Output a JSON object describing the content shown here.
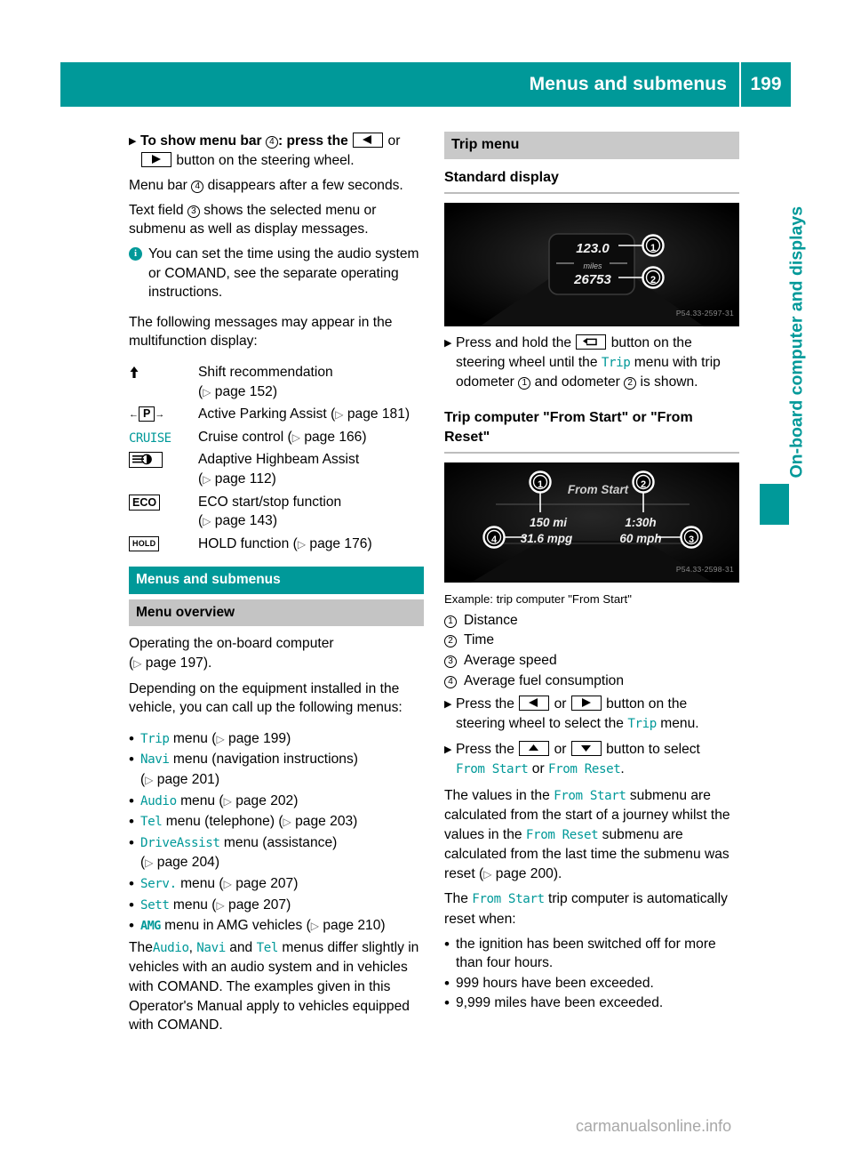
{
  "header": {
    "title": "Menus and submenus",
    "page_number": "199",
    "accent_color": "#009999"
  },
  "side_tab": {
    "label": "On-board computer and displays"
  },
  "left_column": {
    "step_show_menu_bar": {
      "bold_lead": "To show menu bar",
      "callout": "4",
      "after_callout": ": press the",
      "or_word": "or",
      "tail": "button on the steering wheel."
    },
    "para_menu_bar_disappears_pre": "Menu bar",
    "para_menu_bar_callout": "4",
    "para_menu_bar_disappears_post": "disappears after a few seconds.",
    "para_text_field_pre": "Text field",
    "para_text_field_callout": "3",
    "para_text_field_post": "shows the selected menu or submenu as well as display messages.",
    "note": "You can set the time using the audio system or COMAND, see the separate operating instructions.",
    "messages_intro": "The following messages may appear in the multifunction display:",
    "messages": [
      {
        "icon": "shift-up-arrow-icon",
        "icon_text": "⬆",
        "label": "Shift recommendation",
        "page_ref": "page 152",
        "ref_on_new_line": true
      },
      {
        "icon": "active-parking-assist-icon",
        "icon_text": "P",
        "label": "Active Parking Assist",
        "page_ref": "page 181",
        "ref_on_new_line": false
      },
      {
        "icon": "cruise-icon",
        "icon_text": "CRUISE",
        "label": "Cruise control",
        "page_ref": "page 166",
        "ref_on_new_line": false
      },
      {
        "icon": "adaptive-highbeam-assist-icon",
        "icon_text": "",
        "label": "Adaptive Highbeam Assist",
        "page_ref": "page 112",
        "ref_on_new_line": true
      },
      {
        "icon": "eco-icon",
        "icon_text": "ECO",
        "label": "ECO start/stop function",
        "page_ref": "page 143",
        "ref_on_new_line": true
      },
      {
        "icon": "hold-icon",
        "icon_text": "HOLD",
        "label": "HOLD function",
        "page_ref": "page 176",
        "ref_on_new_line": false
      }
    ],
    "section_bar": "Menus and submenus",
    "subsection_bar": "Menu overview",
    "operating_line1": "Operating the on-board computer",
    "operating_ref": "page 197",
    "operating_tail": ").",
    "depending_text": "Depending on the equipment installed in the vehicle, you can call up the following menus:",
    "menu_items": [
      {
        "term": "Trip",
        "desc": "menu",
        "page_ref": "page 199",
        "ref_new_line": false
      },
      {
        "term": "Navi",
        "desc": "menu (navigation instructions)",
        "page_ref": "page 201",
        "ref_new_line": true
      },
      {
        "term": "Audio",
        "desc": "menu",
        "page_ref": "page 202",
        "ref_new_line": false
      },
      {
        "term": "Tel",
        "desc": "menu (telephone)",
        "page_ref": "page 203",
        "ref_new_line": false
      },
      {
        "term": "DriveAssist",
        "desc": "menu (assistance)",
        "page_ref": "page 204",
        "ref_new_line": true
      },
      {
        "term": "Serv.",
        "desc": "menu",
        "page_ref": "page 207",
        "ref_new_line": false
      },
      {
        "term": "Sett",
        "desc": "menu",
        "page_ref": "page 207",
        "ref_new_line": false
      },
      {
        "term": "AMG",
        "desc": "menu in AMG vehicles",
        "page_ref": "page 210",
        "ref_new_line": false
      }
    ],
    "closing_paragraph": {
      "p1": "The",
      "t1": "Audio",
      "p2": ",",
      "t2": "Navi",
      "p3": "and",
      "t3": "Tel",
      "p4": "menus differ slightly in vehicles with an audio system and in vehicles with COMAND. The examples given in this Operator's Manual apply to vehicles equipped with COMAND."
    }
  },
  "right_column": {
    "trip_menu_bar": "Trip menu",
    "standard_display_heading": "Standard display",
    "figure1": {
      "odometer_trip": "123.0",
      "unit": "miles",
      "odometer_total": "26753",
      "callout_1": "1",
      "callout_2": "2",
      "code": "P54.33-2597-31"
    },
    "step_press_hold": {
      "lead": "Press and hold the",
      "mid": "button on the steering wheel until the",
      "term": "Trip",
      "mid2": "menu with trip odometer",
      "callout_1": "1",
      "and": "and odometer",
      "callout_2": "2",
      "tail": "is shown."
    },
    "trip_computer_heading": "Trip computer \"From Start\" or \"From Reset\"",
    "figure2": {
      "title": "From Start",
      "distance": "150 mi",
      "time": "1:30h",
      "consumption": "31.6 mpg",
      "speed": "60 mph",
      "callout_1": "1",
      "callout_2": "2",
      "callout_3": "3",
      "callout_4": "4",
      "code": "P54.33-2598-31"
    },
    "figure2_caption": "Example: trip computer \"From Start\"",
    "legend": [
      {
        "num": "1",
        "label": "Distance"
      },
      {
        "num": "2",
        "label": "Time"
      },
      {
        "num": "3",
        "label": "Average speed"
      },
      {
        "num": "4",
        "label": "Average fuel consumption"
      }
    ],
    "step_select_trip": {
      "lead": "Press the",
      "or": "or",
      "mid": "button on the steering wheel to select the",
      "term": "Trip",
      "tail": "menu."
    },
    "step_select_submenu": {
      "lead": "Press the",
      "or": "or",
      "mid": "button to select",
      "term1": "From Start",
      "or2": "or",
      "term2": "From Reset",
      "tail": "."
    },
    "values_paragraph": {
      "p1": "The values in the",
      "t1": "From Start",
      "p2": "submenu are calculated from the start of a journey whilst the values in the",
      "t2": "From Reset",
      "p3": "submenu are calculated from the last time the submenu was reset (",
      "ref": "page 200",
      "p4": ")."
    },
    "auto_reset_paragraph": {
      "p1": "The",
      "t1": "From Start",
      "p2": "trip computer is automatically reset when:"
    },
    "reset_conditions": [
      "the ignition has been switched off for more than four hours.",
      "999 hours have been exceeded.",
      "9,999 miles have been exceeded."
    ]
  },
  "watermark": "carmanualsonline.info"
}
